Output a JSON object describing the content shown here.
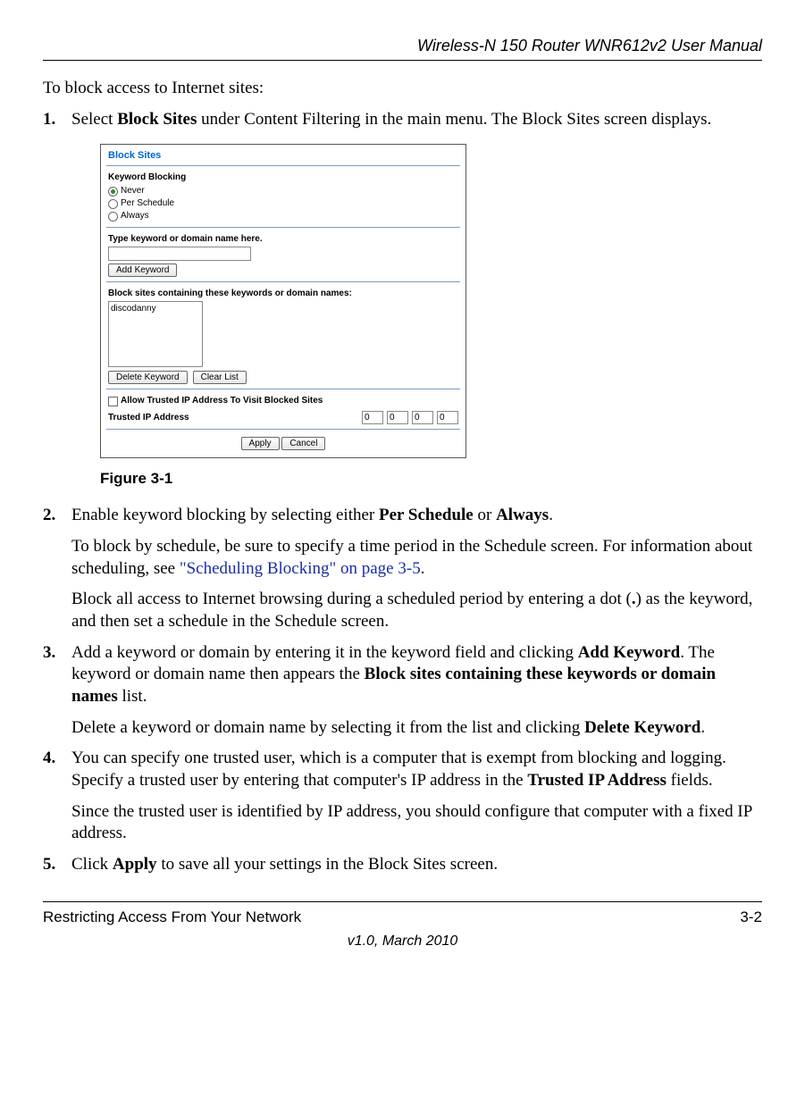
{
  "header": {
    "title": "Wireless-N 150 Router WNR612v2 User Manual"
  },
  "intro": "To block access to Internet sites:",
  "steps": {
    "s1": {
      "num": "1.",
      "pre": "Select ",
      "bold": "Block Sites",
      "post": " under Content Filtering in the main menu. The Block Sites screen displays."
    },
    "figure_label": "Figure 3-1",
    "s2": {
      "num": "2.",
      "p1_pre": "Enable keyword blocking by selecting either ",
      "p1_b1": "Per Schedule",
      "p1_mid": " or ",
      "p1_b2": "Always",
      "p1_post": ".",
      "p2_pre": "To block by schedule, be sure to specify a time period in the Schedule screen. For information about scheduling, see ",
      "p2_link": "\"Scheduling Blocking\" on page 3-5",
      "p2_post": ".",
      "p3_pre": "Block all access to Internet browsing during a scheduled period by entering a dot (",
      "p3_b": ".",
      "p3_post": ") as the keyword, and then set a schedule in the Schedule screen."
    },
    "s3": {
      "num": "3.",
      "p1_pre": "Add a keyword or domain by entering it in the keyword field and clicking ",
      "p1_b1": "Add Keyword",
      "p1_mid": ". The keyword or domain name then appears the ",
      "p1_b2": "Block sites containing these keywords or domain names",
      "p1_post": " list.",
      "p2_pre": "Delete a keyword or domain name by selecting it from the list and clicking ",
      "p2_b": "Delete Keyword",
      "p2_post": "."
    },
    "s4": {
      "num": "4.",
      "p1_pre": "You can specify one trusted user, which is a computer that is exempt from blocking and logging. Specify a trusted user by entering that computer's IP address in the ",
      "p1_b": "Trusted IP Address",
      "p1_post": " fields.",
      "p2": "Since the trusted user is identified by IP address, you should configure that computer with a fixed IP address."
    },
    "s5": {
      "num": "5.",
      "pre": "Click ",
      "bold": "Apply",
      "post": " to save all your settings in the Block Sites screen."
    }
  },
  "screenshot": {
    "title": "Block Sites",
    "keyword_blocking_label": "Keyword Blocking",
    "radios": {
      "never": "Never",
      "per_schedule": "Per Schedule",
      "always": "Always"
    },
    "type_keyword_label": "Type keyword or domain name here.",
    "add_keyword_btn": "Add Keyword",
    "list_label": "Block sites containing these keywords or domain names:",
    "list_item": "discodanny",
    "delete_keyword_btn": "Delete Keyword",
    "clear_list_btn": "Clear List",
    "allow_trusted_label": "Allow Trusted IP Address To Visit Blocked Sites",
    "trusted_ip_label": "Trusted IP Address",
    "ip": {
      "a": "0",
      "b": "0",
      "c": "0",
      "d": "0"
    },
    "apply_btn": "Apply",
    "cancel_btn": "Cancel"
  },
  "footer": {
    "left": "Restricting Access From Your Network",
    "right": "3-2",
    "center": "v1.0, March 2010"
  }
}
